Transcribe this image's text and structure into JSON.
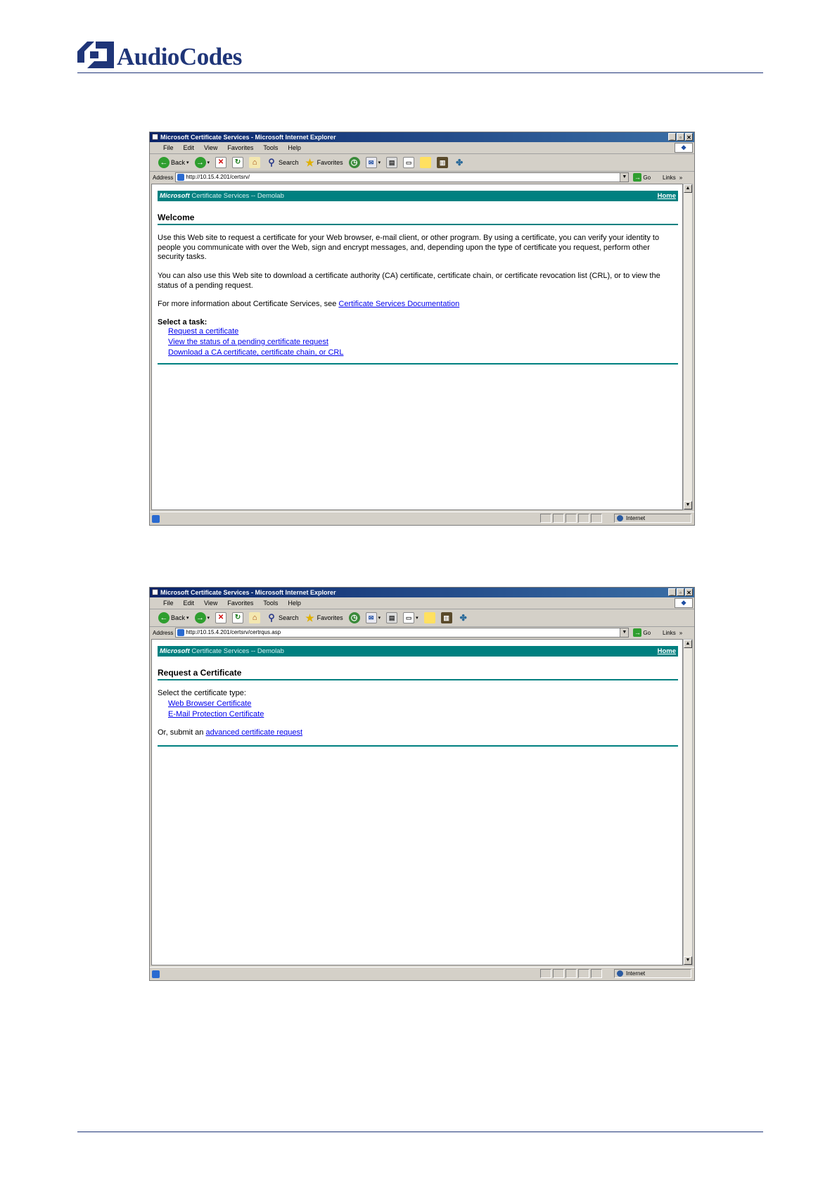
{
  "header": {
    "logo_text": "AudioCodes"
  },
  "windows": [
    {
      "title": "Microsoft Certificate Services - Microsoft Internet Explorer",
      "menu": [
        "File",
        "Edit",
        "View",
        "Favorites",
        "Tools",
        "Help"
      ],
      "toolbar": {
        "back": "Back",
        "search": "Search",
        "favorites": "Favorites"
      },
      "address": {
        "label": "Address",
        "url": "http://10.15.4.201/certsrv/",
        "go": "Go",
        "links": "Links"
      },
      "status": {
        "zone": "Internet"
      },
      "page": {
        "banner_brand": "Microsoft",
        "banner_service": "Certificate Services  --  Demolab",
        "home": "Home",
        "heading": "Welcome",
        "para1": "Use this Web site to request a certificate for your Web browser, e-mail client, or other program. By using a certificate, you can verify your identity to people you communicate with over the Web, sign and encrypt messages, and, depending upon the type of certificate you request, perform other security tasks.",
        "para2": "You can also use this Web site to download a certificate authority (CA) certificate, certificate chain, or certificate revocation list (CRL), or to view the status of a pending request.",
        "para3_prefix": "For more information about Certificate Services, see ",
        "para3_link": "Certificate Services Documentation",
        "task_label": "Select a task:",
        "tasks": [
          "Request a certificate",
          "View the status of a pending certificate request",
          "Download a CA certificate, certificate chain, or CRL"
        ]
      }
    },
    {
      "title": "Microsoft Certificate Services - Microsoft Internet Explorer",
      "menu": [
        "File",
        "Edit",
        "View",
        "Favorites",
        "Tools",
        "Help"
      ],
      "toolbar": {
        "back": "Back",
        "search": "Search",
        "favorites": "Favorites"
      },
      "address": {
        "label": "Address",
        "url": "http://10.15.4.201/certsrv/certrqus.asp",
        "go": "Go",
        "links": "Links"
      },
      "status": {
        "zone": "Internet"
      },
      "page": {
        "banner_brand": "Microsoft",
        "banner_service": "Certificate Services  --  Demolab",
        "home": "Home",
        "heading": "Request a Certificate",
        "select_type": "Select the certificate type:",
        "types": [
          "Web Browser Certificate",
          "E-Mail Protection Certificate"
        ],
        "submit_prefix": "Or, submit an ",
        "submit_link": "advanced certificate request"
      }
    }
  ]
}
